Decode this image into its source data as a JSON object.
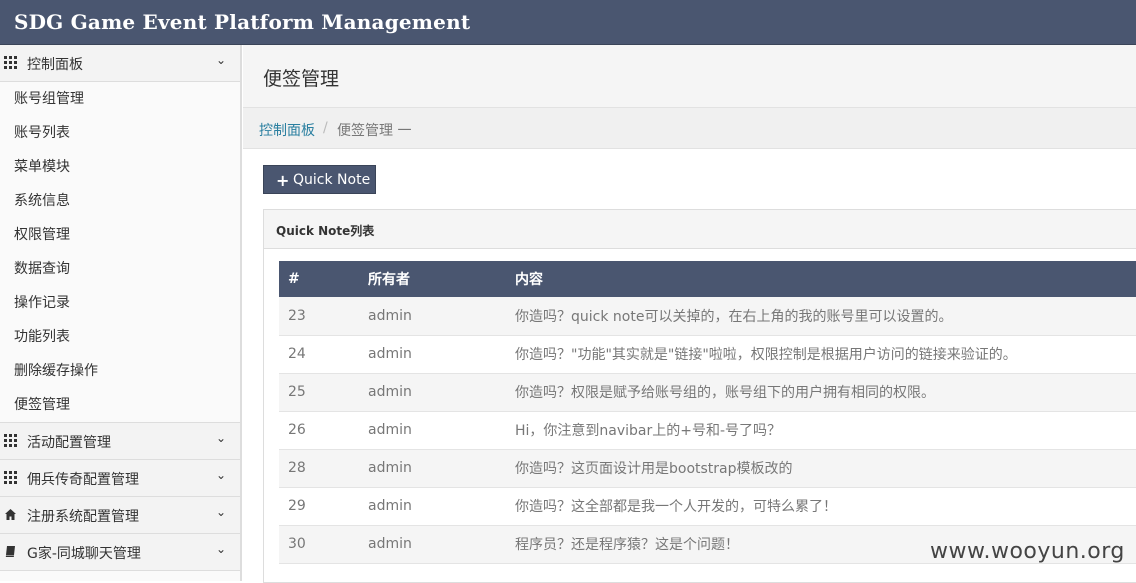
{
  "navbar": {
    "brand": "SDG Game Event Platform Management"
  },
  "sidebar": {
    "control_panel": {
      "label": "控制面板",
      "icon": "grid-icon",
      "items": [
        "账号组管理",
        "账号列表",
        "菜单模块",
        "系统信息",
        "权限管理",
        "数据查询",
        "操作记录",
        "功能列表",
        "删除缓存操作",
        "便签管理"
      ]
    },
    "groups": [
      {
        "label": "活动配置管理",
        "icon": "grid-icon"
      },
      {
        "label": "佣兵传奇配置管理",
        "icon": "grid-icon"
      },
      {
        "label": "注册系统配置管理",
        "icon": "home-icon"
      },
      {
        "label": "G家-同城聊天管理",
        "icon": "book-icon"
      }
    ]
  },
  "page": {
    "title": "便签管理",
    "breadcrumb": {
      "home": "控制面板",
      "current": "便签管理 一"
    },
    "add_button": "Quick Note",
    "panel_title": "Quick Note列表"
  },
  "table": {
    "headers": [
      "#",
      "所有者",
      "内容"
    ],
    "rows": [
      {
        "id": "23",
        "owner": "admin",
        "content": "你造吗？quick note可以关掉的，在右上角的我的账号里可以设置的。"
      },
      {
        "id": "24",
        "owner": "admin",
        "content": "你造吗？\"功能\"其实就是\"链接\"啦啦，权限控制是根据用户访问的链接来验证的。"
      },
      {
        "id": "25",
        "owner": "admin",
        "content": "你造吗？权限是赋予给账号组的，账号组下的用户拥有相同的权限。"
      },
      {
        "id": "26",
        "owner": "admin",
        "content": "Hi，你注意到navibar上的+号和-号了吗？"
      },
      {
        "id": "28",
        "owner": "admin",
        "content": "你造吗？这页面设计用是bootstrap模板改的"
      },
      {
        "id": "29",
        "owner": "admin",
        "content": "你造吗？这全部都是我一个人开发的，可特么累了！"
      },
      {
        "id": "30",
        "owner": "admin",
        "content": "程序员？还是程序猿？这是个问题！"
      }
    ]
  },
  "watermark": "www.wooyun.org",
  "colors": {
    "navbar": "#4a5670",
    "link": "#2a7fa0"
  }
}
